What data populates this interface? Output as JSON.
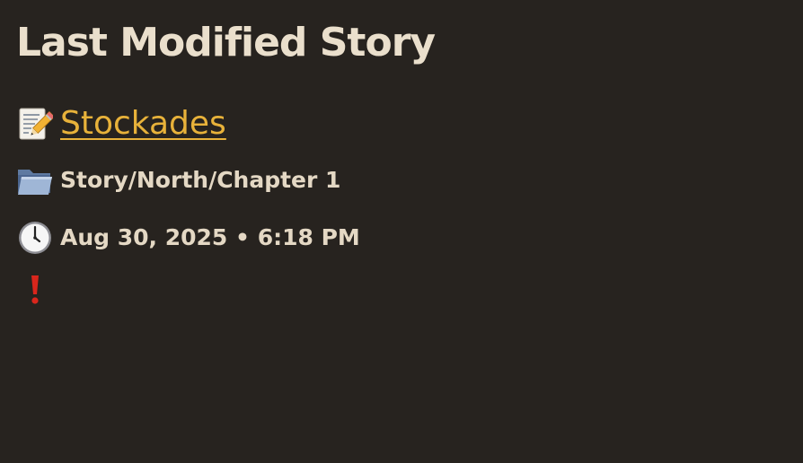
{
  "heading": "Last Modified Story",
  "story": {
    "icon": "memo-pencil-icon",
    "title": "Stockades"
  },
  "location": {
    "icon": "folder-icon",
    "path": "Story/North/Chapter 1"
  },
  "modified": {
    "icon": "clock-icon",
    "timestamp": "Aug 30, 2025 • 6:18 PM"
  },
  "flag": {
    "icon": "exclamation-icon",
    "color": "#d9261c"
  },
  "colors": {
    "background": "#27231f",
    "text": "#e8dcc8",
    "link": "#e8b23a"
  }
}
